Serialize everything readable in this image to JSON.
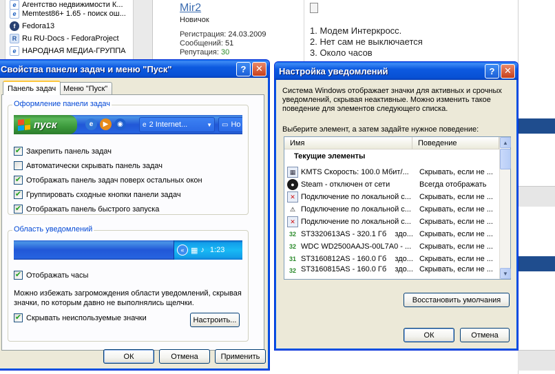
{
  "background": {
    "bookmarks": [
      {
        "icon": "ie-icon",
        "label": "Агентство недвижимости К..."
      },
      {
        "icon": "ie-icon",
        "label": "Memtest86+ 1.65 - поиск ош..."
      },
      {
        "icon": "fedora-icon",
        "label": "Fedora13"
      },
      {
        "icon": "ru-docs-icon",
        "label": "Ru RU-Docs - FedoraProject"
      },
      {
        "icon": "ie-icon",
        "label": "НАРОДНАЯ МЕДИА-ГРУППА"
      }
    ],
    "forum": {
      "username": "Mir2",
      "rank": "Новичок",
      "reg_label": "Регистрация: ",
      "reg_value": "24.03.2009",
      "posts_label": "Сообщений: ",
      "posts_value": "51",
      "rep_label": "Репутация: ",
      "rep_value": "30",
      "post_lines": [
        "1. Модем Интеркросс.",
        "2. Нет сам не выключается",
        "3. Около часов"
      ]
    }
  },
  "left_dialog": {
    "title": "Свойства панели задач и меню \"Пуск\"",
    "help_btn": "?",
    "close_btn": "✕",
    "tabs": [
      "Панель задач",
      "Меню \"Пуск\""
    ],
    "taskbar_group": {
      "label": "Оформление панели задач",
      "start_label": "пуск",
      "task_label": "2 Internet...",
      "task2_label": "Но",
      "checkboxes": [
        {
          "label": "Закрепить панель задач",
          "checked": true
        },
        {
          "label": "Автоматически скрывать панель задач",
          "checked": false
        },
        {
          "label": "Отображать панель задач поверх остальных окон",
          "checked": true
        },
        {
          "label": "Группировать сходные кнопки панели задач",
          "checked": true
        },
        {
          "label": "Отображать панель быстрого запуска",
          "checked": true
        }
      ]
    },
    "notify_group": {
      "label": "Область уведомлений",
      "clock": "1:23",
      "show_clock": {
        "label": "Отображать часы",
        "checked": true
      },
      "description": "Можно избежать загромождения области уведомлений, скрывая значки, по которым давно не выполнялись щелчки.",
      "hide_icons": {
        "label": "Скрывать неиспользуемые значки",
        "checked": true
      },
      "configure_btn": "Настроить..."
    },
    "buttons": {
      "ok": "ОК",
      "cancel": "Отмена",
      "apply": "Применить"
    }
  },
  "right_dialog": {
    "title": "Настройка уведомлений",
    "help_btn": "?",
    "close_btn": "✕",
    "description": "Система Windows отображает значки для активных и срочных уведомлений, скрывая неактивные. Можно изменить такое поведение для элементов следующего списка.",
    "instruction": "Выберите элемент, а затем задайте нужное поведение:",
    "columns": [
      "Имя",
      "Поведение"
    ],
    "group_header": "Текущие элементы",
    "rows": [
      {
        "icon": "network-icon",
        "name": "KMTS Скорость: 100.0 Мбит/...",
        "behavior": "Скрывать, если не ..."
      },
      {
        "icon": "steam-icon",
        "name": "Steam - отключен от сети",
        "behavior": "Всегда отображать"
      },
      {
        "icon": "network-disconnected-icon",
        "name": "Подключение по локальной с...",
        "behavior": "Скрывать, если не ..."
      },
      {
        "icon": "warning-icon",
        "name": "Подключение по локальной с...",
        "behavior": "Скрывать, если не ..."
      },
      {
        "icon": "network-disconnected-icon",
        "name": "Подключение по локальной с...",
        "behavior": "Скрывать, если не ..."
      },
      {
        "icon": "hdd-temp-icon",
        "name": "ST3320613AS - 320.1 Гб    здо...",
        "behavior": "Скрывать, если не ..."
      },
      {
        "icon": "hdd-temp-icon",
        "name": "WDC WD2500AAJS-00L7A0 - ...",
        "behavior": "Скрывать, если не ..."
      },
      {
        "icon": "hdd-temp-icon",
        "name": "ST3160812AS - 160.0 Гб    здо...",
        "behavior": "Скрывать, если не ..."
      },
      {
        "icon": "hdd-temp-icon",
        "name": "ST3160815AS - 160.0 Гб    здо...",
        "behavior": "Скрывать, если не ..."
      }
    ],
    "restore_btn": "Восстановить умолчания",
    "buttons": {
      "ok": "ОК",
      "cancel": "Отмена"
    }
  }
}
